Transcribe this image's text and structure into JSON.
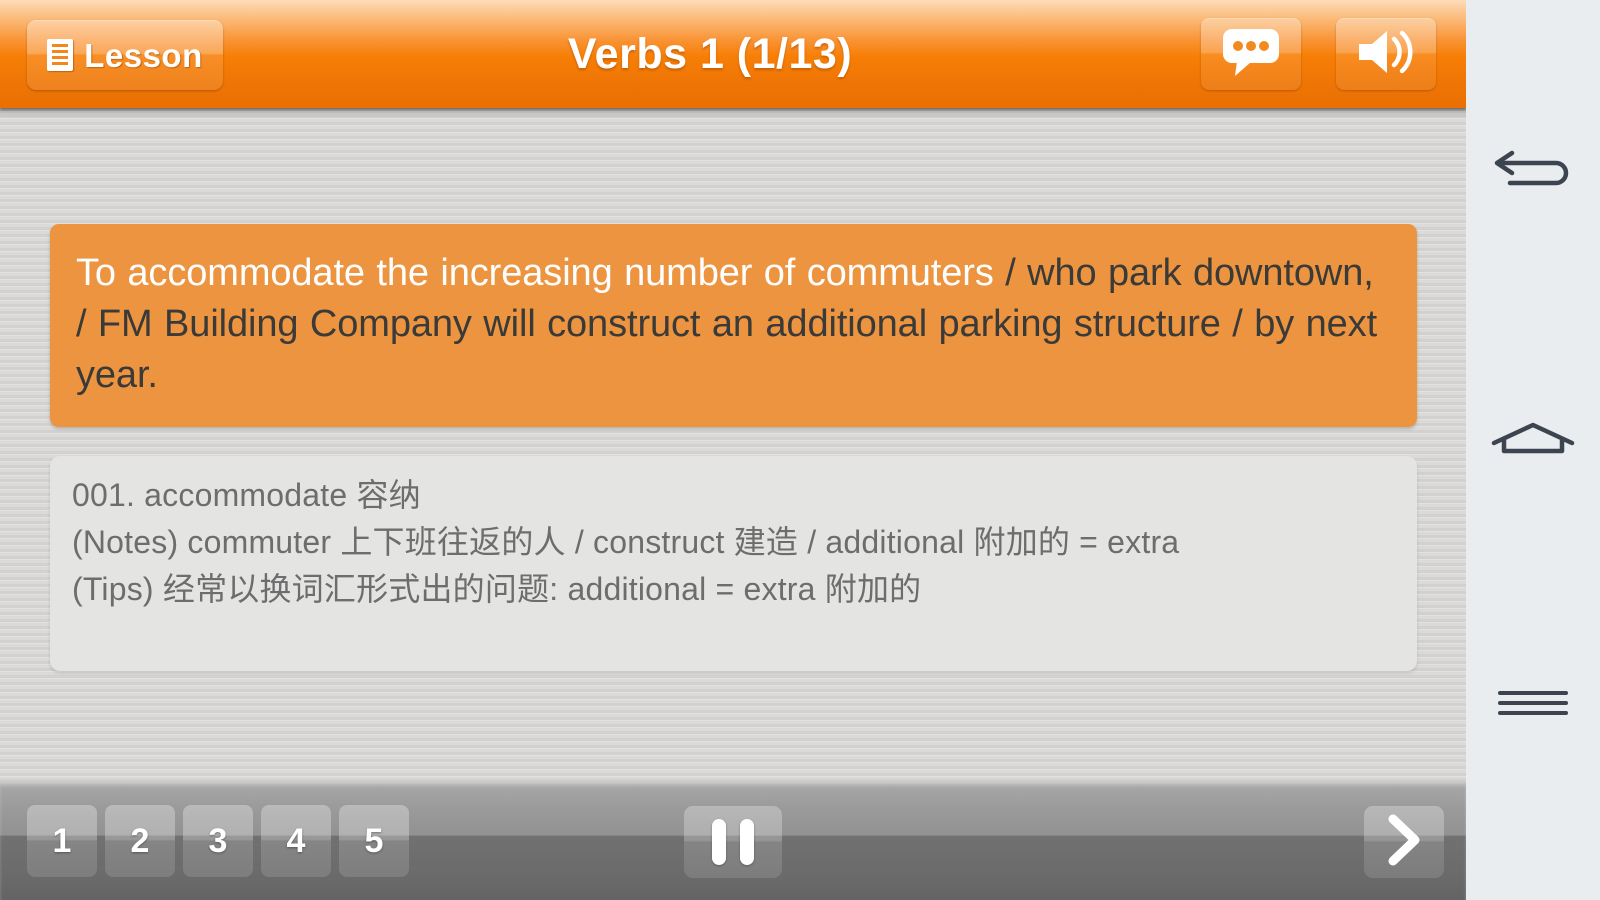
{
  "header": {
    "lesson_button_label": "Lesson",
    "lesson_icon": "list-document-icon",
    "title": "Verbs 1 (1/13)",
    "chat_icon": "speech-bubble-icon",
    "sound_icon": "speaker-volume-icon",
    "bg_top_color": "#fddcb8",
    "bg_bottom_color": "#e96f04"
  },
  "sentence": {
    "highlighted": "To accommodate the increasing number of commuters",
    "rest": " / who park downtown, / FM Building Company will construct an additional parking structure / by next year.",
    "full_text": "To accommodate the increasing number of commuters / who park downtown, / FM Building Company will construct an additional parking structure / by next year.",
    "box_color": "#ed9440",
    "highlight_color": "#ffffff",
    "text_color": "#3a3a38"
  },
  "notes": {
    "box_color": "#e4e4e3",
    "text_color": "#6d6d6d",
    "lines": [
      "001. accommodate 容纳",
      "(Notes) commuter 上下班往返的人 / construct 建造 / additional 附加的 = extra",
      "(Tips) 经常以换词汇形式出的问题: additional = extra 附加的"
    ]
  },
  "bottombar": {
    "numbers": [
      "1",
      "2",
      "3",
      "4",
      "5"
    ],
    "pause_icon": "pause-icon",
    "pause_label": "Pause",
    "next_icon": "chevron-right-icon",
    "next_label": "Next"
  },
  "navbar": {
    "back_icon": "back-arrow-icon",
    "home_icon": "home-icon",
    "recent_icon": "recent-apps-icon",
    "bg_color": "#e9edf0",
    "icon_color": "#3c4450"
  }
}
